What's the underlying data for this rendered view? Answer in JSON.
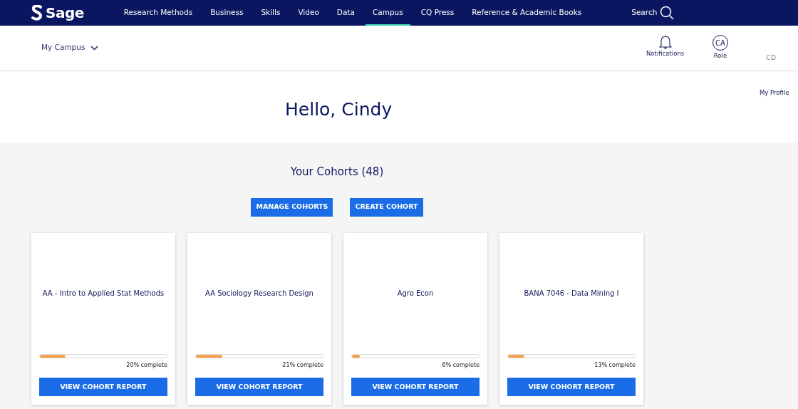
{
  "brand": {
    "name": "Sage"
  },
  "nav": [
    {
      "label": "Research Methods",
      "selected": false
    },
    {
      "label": "Business",
      "selected": false
    },
    {
      "label": "Skills",
      "selected": false
    },
    {
      "label": "Video",
      "selected": false
    },
    {
      "label": "Data",
      "selected": false
    },
    {
      "label": "Campus",
      "selected": true
    },
    {
      "label": "CQ Press",
      "selected": false
    },
    {
      "label": "Reference & Academic Books",
      "selected": false
    }
  ],
  "search": {
    "label": "Search"
  },
  "subheader": {
    "menu": "My Campus",
    "notifications": "Notifications",
    "role_initials": "CA",
    "role": "Role",
    "profile_initials": "CD",
    "profile": "My Profile"
  },
  "greeting": "Hello, Cindy",
  "cohorts": {
    "title": "Your Cohorts (48)",
    "buttons": [
      "MANAGE COHORTS",
      "CREATE COHORT"
    ],
    "cards": [
      {
        "title": "AA - Intro to Applied Stat Methods",
        "level": 0.2,
        "reading": "20% complete",
        "button": "VIEW COHORT REPORT"
      },
      {
        "title": "AA Sociology Research Design",
        "level": 0.21,
        "reading": "21% complete",
        "button": "VIEW COHORT REPORT"
      },
      {
        "title": "Agro Econ",
        "level": 0.06,
        "reading": "6% complete",
        "button": "VIEW COHORT REPORT"
      },
      {
        "title": "BANA 7046 - Data Mining I",
        "level": 0.13,
        "reading": "13% complete",
        "button": "VIEW COHORT REPORT"
      }
    ]
  }
}
